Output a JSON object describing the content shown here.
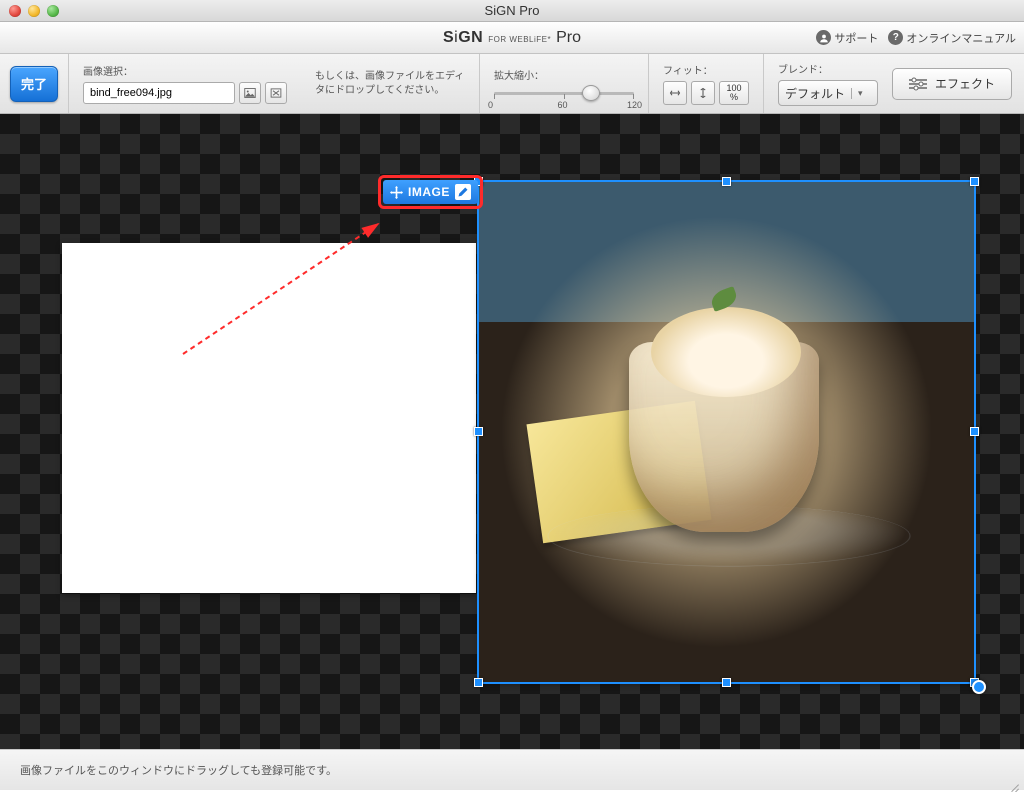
{
  "titlebar": {
    "title": "SiGN Pro"
  },
  "brand": {
    "name": "SiGN",
    "sub": "FOR WEBLiFE*",
    "suffix": "Pro",
    "support": "サポート",
    "manual": "オンラインマニュアル"
  },
  "toolbar": {
    "done": "完了",
    "image_select_label": "画像選択：",
    "filename": "bind_free094.jpg",
    "hint": "もしくは、画像ファイルをエディタにドロップしてください。",
    "zoom_label": "拡大縮小：",
    "zoom_ticks": {
      "min": "0",
      "mid": "60",
      "max": "120"
    },
    "fit_label": "フィット：",
    "pct_top": "100",
    "pct_bottom": "%",
    "blend_label": "ブレンド：",
    "blend_value": "デフォルト",
    "effect": "エフェクト"
  },
  "canvas": {
    "tag_label": "IMAGE"
  },
  "status": {
    "text": "画像ファイルをこのウィンドウにドラッグしても登録可能です。"
  }
}
